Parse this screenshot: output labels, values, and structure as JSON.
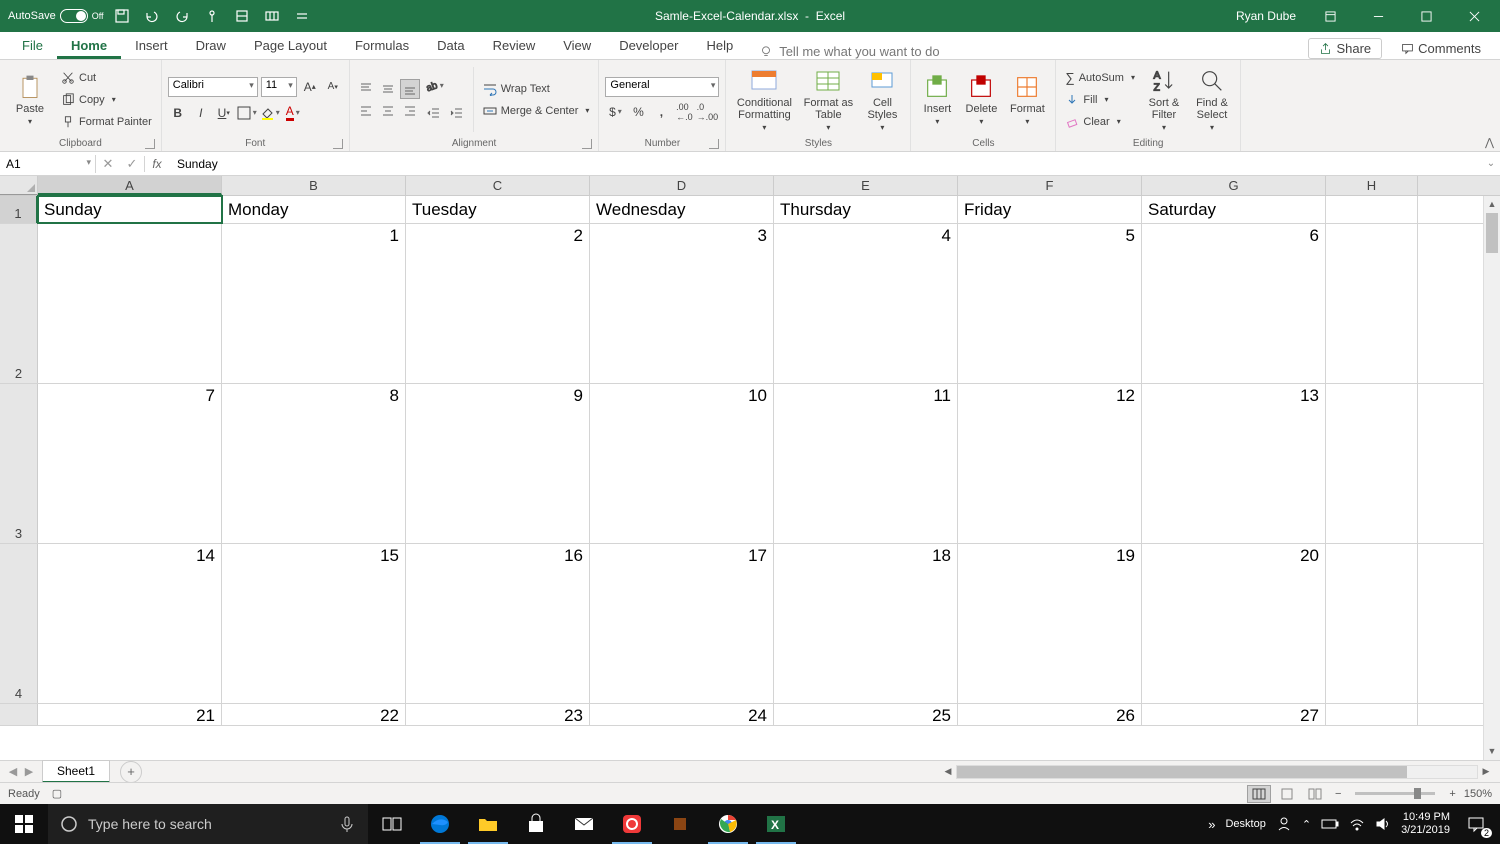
{
  "titlebar": {
    "autosave_label": "AutoSave",
    "autosave_state": "Off",
    "filename": "Samle-Excel-Calendar.xlsx",
    "app": "Excel",
    "user": "Ryan Dube"
  },
  "tabs": {
    "file": "File",
    "home": "Home",
    "insert": "Insert",
    "draw": "Draw",
    "page_layout": "Page Layout",
    "formulas": "Formulas",
    "data": "Data",
    "review": "Review",
    "view": "View",
    "developer": "Developer",
    "help": "Help",
    "tellme": "Tell me what you want to do",
    "share": "Share",
    "comments": "Comments"
  },
  "ribbon": {
    "clipboard": {
      "label": "Clipboard",
      "paste": "Paste",
      "cut": "Cut",
      "copy": "Copy",
      "format_painter": "Format Painter"
    },
    "font": {
      "label": "Font",
      "name": "Calibri",
      "size": "11"
    },
    "alignment": {
      "label": "Alignment",
      "wrap": "Wrap Text",
      "merge": "Merge & Center"
    },
    "number": {
      "label": "Number",
      "format": "General"
    },
    "styles": {
      "label": "Styles",
      "cond": "Conditional Formatting",
      "table": "Format as Table",
      "cell": "Cell Styles"
    },
    "cells": {
      "label": "Cells",
      "insert": "Insert",
      "delete": "Delete",
      "format": "Format"
    },
    "editing": {
      "label": "Editing",
      "autosum": "AutoSum",
      "fill": "Fill",
      "clear": "Clear",
      "sort": "Sort & Filter",
      "find": "Find & Select"
    }
  },
  "formula_bar": {
    "name_box": "A1",
    "value": "Sunday"
  },
  "columns": [
    "A",
    "B",
    "C",
    "D",
    "E",
    "F",
    "G",
    "H"
  ],
  "rows": {
    "headers": [
      "Sunday",
      "Monday",
      "Tuesday",
      "Wednesday",
      "Thursday",
      "Friday",
      "Saturday",
      ""
    ],
    "week1": [
      "",
      "1",
      "2",
      "3",
      "4",
      "5",
      "6",
      ""
    ],
    "week2": [
      "7",
      "8",
      "9",
      "10",
      "11",
      "12",
      "13",
      ""
    ],
    "week3": [
      "14",
      "15",
      "16",
      "17",
      "18",
      "19",
      "20",
      ""
    ],
    "week4": [
      "21",
      "22",
      "23",
      "24",
      "25",
      "26",
      "27",
      ""
    ]
  },
  "sheet": {
    "name": "Sheet1"
  },
  "status": {
    "ready": "Ready",
    "zoom": "150%"
  },
  "taskbar": {
    "search_placeholder": "Type here to search",
    "desktop": "Desktop",
    "time": "10:49 PM",
    "date": "3/21/2019",
    "notif_count": "2"
  }
}
